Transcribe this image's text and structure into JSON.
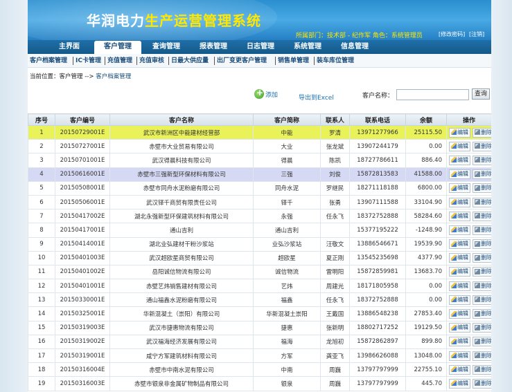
{
  "app": {
    "title_part1": "华润电力",
    "title_part2": "生产运营管理系统",
    "dept_info": "所属部门：技术部 - 纪作军  角色：系统管理员",
    "change_password": "[修改密码]",
    "logout": "[注销]"
  },
  "nav": {
    "items": [
      {
        "label": "主界面"
      },
      {
        "label": "客户管理"
      },
      {
        "label": "查询管理"
      },
      {
        "label": "报表管理"
      },
      {
        "label": "日志管理"
      },
      {
        "label": "系统管理"
      },
      {
        "label": "信息管理"
      }
    ],
    "active_index": 1
  },
  "subnav": {
    "items": [
      {
        "label": "客户档案管理"
      },
      {
        "label": "IC卡管理"
      },
      {
        "label": "充值管理"
      },
      {
        "label": "充值审核"
      },
      {
        "label": "日最大供应量"
      },
      {
        "label": "出厂变更客户管理"
      },
      {
        "label": "销售单管理"
      },
      {
        "label": "装车库位管理"
      }
    ]
  },
  "breadcrumb": {
    "prefix": "当前位置：客户管理",
    "arrow": "-->",
    "current": "客户档案管理"
  },
  "toolbar": {
    "add_label": "添加",
    "export_label": "导出到Excel",
    "search_label": "客户名称：",
    "search_value": "",
    "search_button": "查询"
  },
  "table": {
    "columns": [
      "序号",
      "客户编号",
      "客户名称",
      "客户简称",
      "联系人",
      "联系电话",
      "余额",
      "操作"
    ],
    "edit_label": "编辑",
    "delete_label": "删除",
    "rows": [
      {
        "seq": "1",
        "code": "20150729001E",
        "name": "武汉市新洲区中能建材经营部",
        "short": "中能",
        "contact": "罗清",
        "phone": "13971277966",
        "balance": "25115.50",
        "highlight": "yellow"
      },
      {
        "seq": "2",
        "code": "20150727001E",
        "name": "赤壁市大业贸易有限公司",
        "short": "大业",
        "contact": "张龙斌",
        "phone": "13907244179",
        "balance": "0.00",
        "highlight": ""
      },
      {
        "seq": "3",
        "code": "20150701001E",
        "name": "武汉得晨科技有限公司",
        "short": "得晨",
        "contact": "陈凯",
        "phone": "18727786611",
        "balance": "886.40",
        "highlight": ""
      },
      {
        "seq": "4",
        "code": "20150616001E",
        "name": "赤壁市三强新型环保材料有限公司",
        "short": "三强",
        "contact": "刘俊",
        "phone": "15872813583",
        "balance": "41588.00",
        "highlight": "blue"
      },
      {
        "seq": "5",
        "code": "20150508001E",
        "name": "赤壁市同舟水泥粉磨有限公司",
        "short": "同舟水泥",
        "contact": "罗继民",
        "phone": "18271118188",
        "balance": "6800.00",
        "highlight": ""
      },
      {
        "seq": "6",
        "code": "20150506001E",
        "name": "武汉铎千商贸有限责任公司",
        "short": "铎千",
        "contact": "张勇",
        "phone": "13907111588",
        "balance": "33104.90",
        "highlight": ""
      },
      {
        "seq": "7",
        "code": "20150417002E",
        "name": "湖北永强新型环保建筑材料有限公司",
        "short": "永强",
        "contact": "任永飞",
        "phone": "18372752888",
        "balance": "58284.60",
        "highlight": ""
      },
      {
        "seq": "8",
        "code": "20150417001E",
        "name": "通山吉利",
        "short": "通山吉利",
        "contact": "",
        "phone": "15377195222",
        "balance": "-1248.90",
        "highlight": ""
      },
      {
        "seq": "9",
        "code": "20150414001E",
        "name": "湖北业弘建材干粉沙浆站",
        "short": "业弘沙浆站",
        "contact": "汪敬文",
        "phone": "13886546671",
        "balance": "19539.90",
        "highlight": ""
      },
      {
        "seq": "10",
        "code": "20150401003E",
        "name": "武汉超欧星商贸有限公司",
        "short": "超欧星",
        "contact": "夏正刚",
        "phone": "13545235698",
        "balance": "4377.90",
        "highlight": ""
      },
      {
        "seq": "11",
        "code": "20150401002E",
        "name": "岳阳诚信物流有限公司",
        "short": "诚信物流",
        "contact": "雷明阳",
        "phone": "15872859981",
        "balance": "13683.70",
        "highlight": ""
      },
      {
        "seq": "12",
        "code": "20150401001E",
        "name": "赤壁艺炜销售建材有限公司",
        "short": "艺炜",
        "contact": "周建光",
        "phone": "18171805958",
        "balance": "0.00",
        "highlight": ""
      },
      {
        "seq": "13",
        "code": "20150330001E",
        "name": "通山福鑫水泥粉磨有限公司",
        "short": "福鑫",
        "contact": "任永飞",
        "phone": "18372752888",
        "balance": "0.00",
        "highlight": ""
      },
      {
        "seq": "14",
        "code": "20150325001E",
        "name": "华新混凝土（崇阳）有限公司",
        "short": "华新混凝土崇阳",
        "contact": "王戴国",
        "phone": "13886548238",
        "balance": "27853.40",
        "highlight": ""
      },
      {
        "seq": "15",
        "code": "20150319003E",
        "name": "武汉市捷惠物流有限公司",
        "short": "捷惠",
        "contact": "张新明",
        "phone": "18802717252",
        "balance": "19129.50",
        "highlight": ""
      },
      {
        "seq": "16",
        "code": "20150319002E",
        "name": "武汉福海经济发展有限公司",
        "short": "福海",
        "contact": "龙旭初",
        "phone": "15872862897",
        "balance": "899.80",
        "highlight": ""
      },
      {
        "seq": "17",
        "code": "20150319001E",
        "name": "咸宁方军建筑材料有限公司",
        "short": "方军",
        "contact": "龚亚飞",
        "phone": "13986626088",
        "balance": "13048.00",
        "highlight": ""
      },
      {
        "seq": "18",
        "code": "20150316004E",
        "name": "赤壁市中南水泥有限公司",
        "short": "中南",
        "contact": "周巍",
        "phone": "13797797999",
        "balance": "22755.10",
        "highlight": ""
      },
      {
        "seq": "19",
        "code": "20150316003E",
        "name": "赤壁市银泉非金属矿物制品有限公司",
        "short": "银泉",
        "contact": "周巍",
        "phone": "13797797999",
        "balance": "445.70",
        "highlight": ""
      }
    ]
  }
}
